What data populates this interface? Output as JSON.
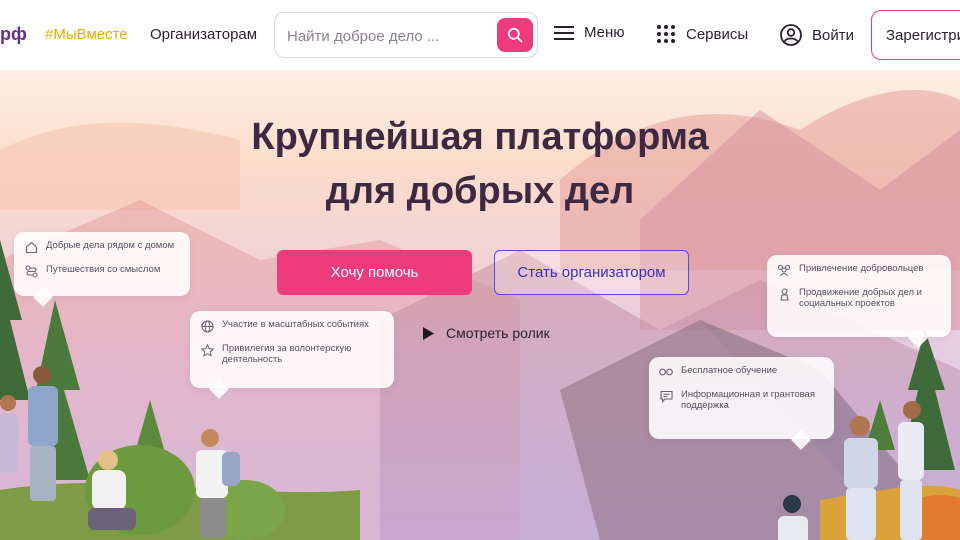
{
  "header": {
    "logo_fragment": "рф",
    "hashtag": "#МыВместе",
    "organizers_link": "Организаторам",
    "search": {
      "placeholder": "Найти доброе дело ..."
    },
    "menu_label": "Меню",
    "services_label": "Сервисы",
    "login_label": "Войти",
    "register_label": "Зарегистрироваться"
  },
  "hero": {
    "title_line1": "Крупнейшая платформа",
    "title_line2": "для добрых дел",
    "primary_button": "Хочу помочь",
    "secondary_button": "Стать организатором",
    "video_link": "Смотреть ролик"
  },
  "cards": {
    "card1": {
      "items": [
        {
          "icon": "home-icon",
          "text": "Добрые дела рядом с домом"
        },
        {
          "icon": "route-icon",
          "text": "Путешествия со смыслом"
        }
      ]
    },
    "card2": {
      "items": [
        {
          "icon": "globe-icon",
          "text": "Участие в масштабных событиях"
        },
        {
          "icon": "star-icon",
          "text": "Привилегия за волонтерскую деятельность"
        }
      ]
    },
    "card3": {
      "items": [
        {
          "icon": "people-icon",
          "text": "Привлечение добровольцев"
        },
        {
          "icon": "megaphone-icon",
          "text": "Продвижение добрых дел и социальных проектов"
        }
      ]
    },
    "card4": {
      "items": [
        {
          "icon": "glasses-icon",
          "text": "Бесплатное обучение"
        },
        {
          "icon": "chat-icon",
          "text": "Информационная и грантовая поддержка"
        }
      ]
    }
  },
  "colors": {
    "accent": "#ee3b7b",
    "brand": "#6a2d86",
    "hashtag": "#f2a900",
    "outline": "#5a4ad8"
  }
}
